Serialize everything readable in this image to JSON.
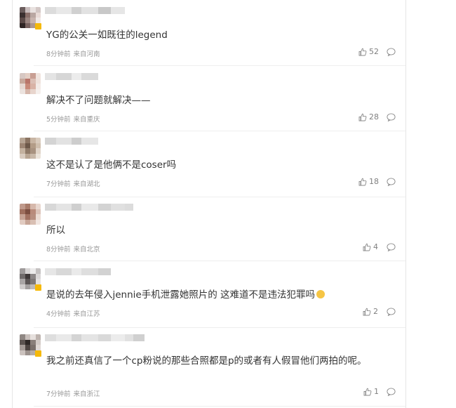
{
  "comments": [
    {
      "text": "YG的公关一如既往的legend",
      "time": "8分钟前",
      "location": "来自河南",
      "likes": "52",
      "emoji": null,
      "avatar_colors": [
        "#6b5d5d",
        "#c9bdbd",
        "#e9e2e0",
        "#d3c7c5",
        "#3a2f2f",
        "#8a6f6a",
        "#b9a7a2",
        "#e8dad6",
        "#5b4a48",
        "#9a8580",
        "#c8b4ae",
        "#f0e8e5",
        "#2e2524",
        "#786360",
        "#ad9790",
        "#d9cac5"
      ],
      "name_blur_colors": [
        "#dcdcdc",
        "#e8e8e8",
        "#d0d0d0",
        "#e2e2e2",
        "#c8c8c8",
        "#e6e6e6"
      ]
    },
    {
      "text": "解决不了问题就解决——",
      "time": "5分钟前",
      "location": "来自重庆",
      "likes": "28",
      "emoji": null,
      "avatar_colors": [
        "#d7c8c3",
        "#e4cfc5",
        "#c99f93",
        "#f0e4de",
        "#c7a89c",
        "#b9756a",
        "#dcbfb5",
        "#efe2dc",
        "#e6d8d2",
        "#c88a7a",
        "#d9b3a6",
        "#f3ebe7",
        "#ece3df",
        "#d6b7ab",
        "#e8d5cd",
        "#f5efec"
      ],
      "name_blur_colors": [
        "#e4e4e4",
        "#d6d6d6",
        "#ececec",
        "#dadada"
      ]
    },
    {
      "text": "这不是认了是他俩不是coser吗",
      "time": "7分钟前",
      "location": "来自湖北",
      "likes": "18",
      "emoji": null,
      "avatar_colors": [
        "#b7a594",
        "#8c7563",
        "#c8b5a3",
        "#d9cbbd",
        "#9d8573",
        "#6d5848",
        "#b39c87",
        "#cfbfae",
        "#c4b2a0",
        "#8f7a68",
        "#a89280",
        "#e0d4c8",
        "#d8cbbf",
        "#b8a593",
        "#c9b9a9",
        "#ebe3da"
      ],
      "name_blur_colors": [
        "#d4d4d4",
        "#e2e2e2",
        "#cdcdcd",
        "#e6e6e6"
      ]
    },
    {
      "text": "所以",
      "time": "8分钟前",
      "location": "来自北京",
      "likes": "4",
      "emoji": null,
      "avatar_colors": [
        "#c09a8c",
        "#a87b6a",
        "#d6b8ab",
        "#e8d7cf",
        "#9f6f5e",
        "#7c4e40",
        "#b98b7b",
        "#dcc4ba",
        "#c6a395",
        "#a27262",
        "#b88f80",
        "#ecdcd4",
        "#e1cbc1",
        "#c7a597",
        "#d9bfb3",
        "#f1e6e1"
      ],
      "name_blur_colors": [
        "#d8d8d8",
        "#e4e4e4",
        "#cfcfcf",
        "#e9e9e9",
        "#d3d3d3",
        "#e0e0e0",
        "#dcdcdc"
      ]
    },
    {
      "text": "是说的去年侵入jennie手机泄露她照片的 这难道不是违法犯罪吗",
      "time": "4分钟前",
      "location": "来自江苏",
      "likes": "2",
      "emoji": "thinking-face",
      "avatar_colors": [
        "#9e9a9a",
        "#d7d4d4",
        "#ecebeb",
        "#c4c1c1",
        "#6f6a6a",
        "#3e3838",
        "#8d8888",
        "#d9d6d6",
        "#a9a5a5",
        "#5a5454",
        "#7d7878",
        "#e3e1e1",
        "#cfcccc",
        "#a39f9f",
        "#bdb9b9",
        "#f1f0f0"
      ],
      "name_blur_colors": [
        "#e6e6e6",
        "#d8d8d8",
        "#eaeaea",
        "#dedede",
        "#d2d2d2"
      ]
    },
    {
      "text": "我之前还真信了一个cp粉说的那些合照都是p的或者有人假冒他们两拍的呢。",
      "time": "7分钟前",
      "location": "来自浙江",
      "likes": "1",
      "emoji": null,
      "avatar_colors": [
        "#8f8783",
        "#c8bfbb",
        "#e6e0dd",
        "#bdb3ae",
        "#5c5350",
        "#2f2826",
        "#8a7f7a",
        "#d3cac6",
        "#a59b97",
        "#4e4542",
        "#7b706b",
        "#e0d8d4",
        "#cbc2be",
        "#9c928d",
        "#b6aca7",
        "#efeae8"
      ],
      "name_blur_colors": [
        "#dedede",
        "#e9e9e9",
        "#d4d4d4",
        "#e4e4e4",
        "#d9d9d9",
        "#ececec",
        "#e1e1e1",
        "#d0d0d0"
      ]
    }
  ],
  "colors": {
    "text": "#333333",
    "meta": "#999999",
    "action": "#808080",
    "divider": "#eeeeee",
    "badge": "#f5b90a"
  }
}
